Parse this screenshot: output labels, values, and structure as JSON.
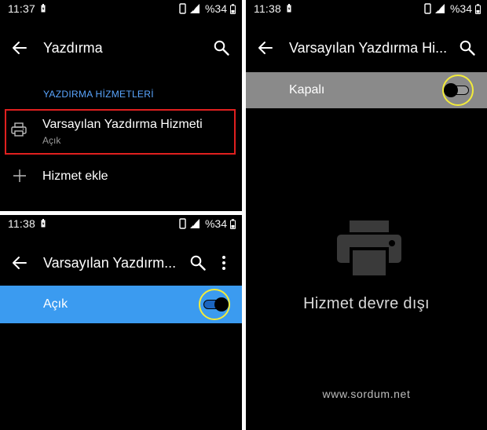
{
  "panel1": {
    "status": {
      "time": "11:37",
      "battery": "%34"
    },
    "title": "Yazdırma",
    "section_header": "YAZDIRMA HİZMETLERİ",
    "service": {
      "title": "Varsayılan Yazdırma Hizmeti",
      "subtitle": "Açık",
      "icon": "printer-icon"
    },
    "add": {
      "label": "Hizmet ekle",
      "icon": "plus-icon"
    }
  },
  "panel2": {
    "status": {
      "time": "11:38",
      "battery": "%34"
    },
    "title": "Varsayılan Yazdırm...",
    "toggle_label": "Açık",
    "toggle_on": true,
    "bar_color": "#3b9bf0"
  },
  "panel3": {
    "status": {
      "time": "11:38",
      "battery": "%34"
    },
    "title": "Varsayılan Yazdırma Hi...",
    "toggle_label": "Kapalı",
    "toggle_on": false,
    "bar_color": "#8a8a8a",
    "empty_icon": "printer-icon",
    "empty_text": "Hizmet devre dışı",
    "watermark": "www.sordum.net"
  },
  "colors": {
    "highlight_ring": "#f3ec3a",
    "callout_border": "#e0201f",
    "accent": "#5aa6ff"
  }
}
